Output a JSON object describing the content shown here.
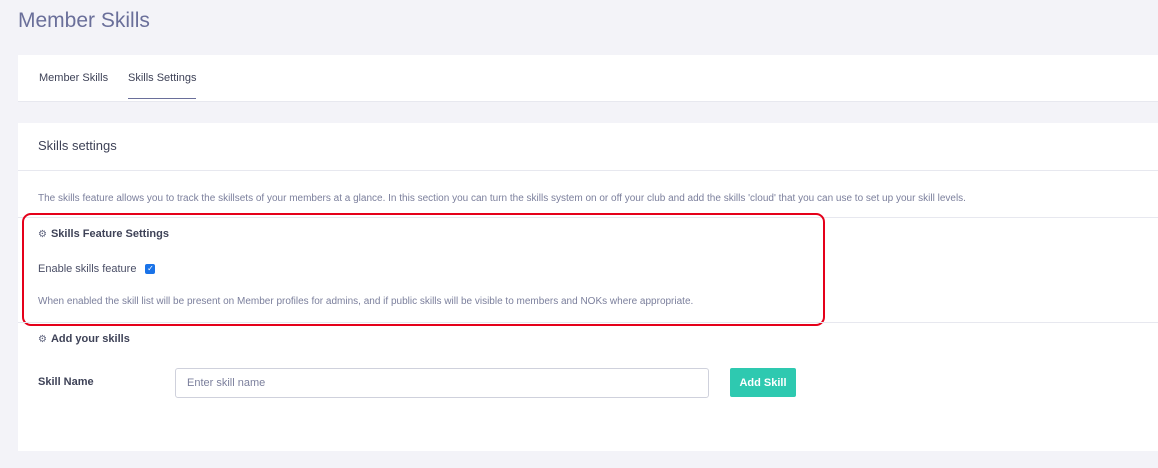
{
  "page": {
    "title": "Member Skills"
  },
  "tabs": [
    {
      "label": "Member Skills"
    },
    {
      "label": "Skills Settings",
      "active": true
    }
  ],
  "card": {
    "title": "Skills settings",
    "intro": "The skills feature allows you to track the skillsets of your members at a glance. In this section you can turn the skills system on or off your club and add the skills 'cloud' that you can use to set up your skill levels."
  },
  "feature_settings": {
    "heading": "Skills Feature Settings",
    "enable_label": "Enable skills feature",
    "enabled": true,
    "help": "When enabled the skill list will be present on Member profiles for admins, and if public skills will be visible to members and NOKs where appropriate."
  },
  "add_skills": {
    "heading": "Add your skills",
    "field_label": "Skill Name",
    "placeholder": "Enter skill name",
    "value": "",
    "button_label": "Add Skill"
  },
  "icons": {
    "section": "gear-icon",
    "checkbox": "check-icon"
  },
  "colors": {
    "accent": "#2ec9b0",
    "highlight": "#e5001a",
    "checkbox": "#1a73e8"
  }
}
